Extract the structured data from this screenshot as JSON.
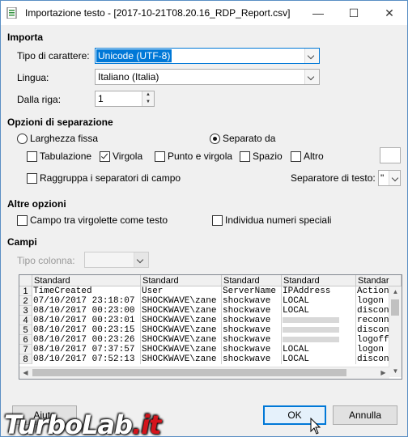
{
  "window": {
    "title": "Importazione testo - [2017-10-21T08.20.16_RDP_Report.csv]",
    "close_label": "✕",
    "maximize_label": "☐",
    "minimize_label": "—"
  },
  "import": {
    "section": "Importa",
    "charset_label": "Tipo di carattere:",
    "charset_value": "Unicode (UTF-8)",
    "language_label": "Lingua:",
    "language_value": "Italiano (Italia)",
    "from_row_label": "Dalla riga:",
    "from_row_value": "1"
  },
  "separators": {
    "section": "Opzioni di separazione",
    "fixed_width": "Larghezza fissa",
    "separated_by": "Separato da",
    "tab": "Tabulazione",
    "comma": "Virgola",
    "semicolon": "Punto e virgola",
    "space": "Spazio",
    "other": "Altro",
    "merge": "Raggruppa i separatori di campo",
    "text_delimiter_label": "Separatore di testo:",
    "text_delimiter_value": "\"",
    "checked": {
      "fixed_width": false,
      "separated_by": true,
      "tab": false,
      "comma": true,
      "semicolon": false,
      "space": false,
      "other": false,
      "merge": false
    }
  },
  "other_options": {
    "section": "Altre opzioni",
    "quoted_as_text": "Campo tra virgolette come testo",
    "detect_numbers": "Individua numeri speciali"
  },
  "fields": {
    "section": "Campi",
    "column_type_label": "Tipo colonna:",
    "column_type_value": "",
    "headers": [
      "Standard",
      "Standard",
      "Standard",
      "Standard",
      "Standar"
    ],
    "rows": [
      {
        "n": "1",
        "c": [
          "TimeCreated",
          "User",
          "ServerName",
          "IPAddress",
          "Action"
        ]
      },
      {
        "n": "2",
        "c": [
          "07/10/2017 23:18:07",
          "SHOCKWAVE\\zane",
          "shockwave",
          "LOCAL",
          "logon"
        ]
      },
      {
        "n": "3",
        "c": [
          "08/10/2017 00:23:00",
          "SHOCKWAVE\\zane",
          "shockwave",
          "LOCAL",
          "discon"
        ]
      },
      {
        "n": "4",
        "c": [
          "08/10/2017 00:23:01",
          "SHOCKWAVE\\zane",
          "shockwave",
          "",
          "reconn"
        ]
      },
      {
        "n": "5",
        "c": [
          "08/10/2017 00:23:15",
          "SHOCKWAVE\\zane",
          "shockwave",
          "",
          "discon"
        ]
      },
      {
        "n": "6",
        "c": [
          "08/10/2017 00:23:26",
          "SHOCKWAVE\\zane",
          "shockwave",
          "",
          "logoff"
        ]
      },
      {
        "n": "7",
        "c": [
          "08/10/2017 07:37:57",
          "SHOCKWAVE\\zane",
          "shockwave",
          "LOCAL",
          "logon"
        ]
      },
      {
        "n": "8",
        "c": [
          "08/10/2017 07:52:13",
          "SHOCKWAVE\\zane",
          "shockwave",
          "LOCAL",
          "discon"
        ]
      }
    ]
  },
  "buttons": {
    "help": "Aiuto",
    "ok": "OK",
    "cancel": "Annulla"
  },
  "watermark": {
    "part1": "TurboLab",
    "part2": ".it"
  }
}
